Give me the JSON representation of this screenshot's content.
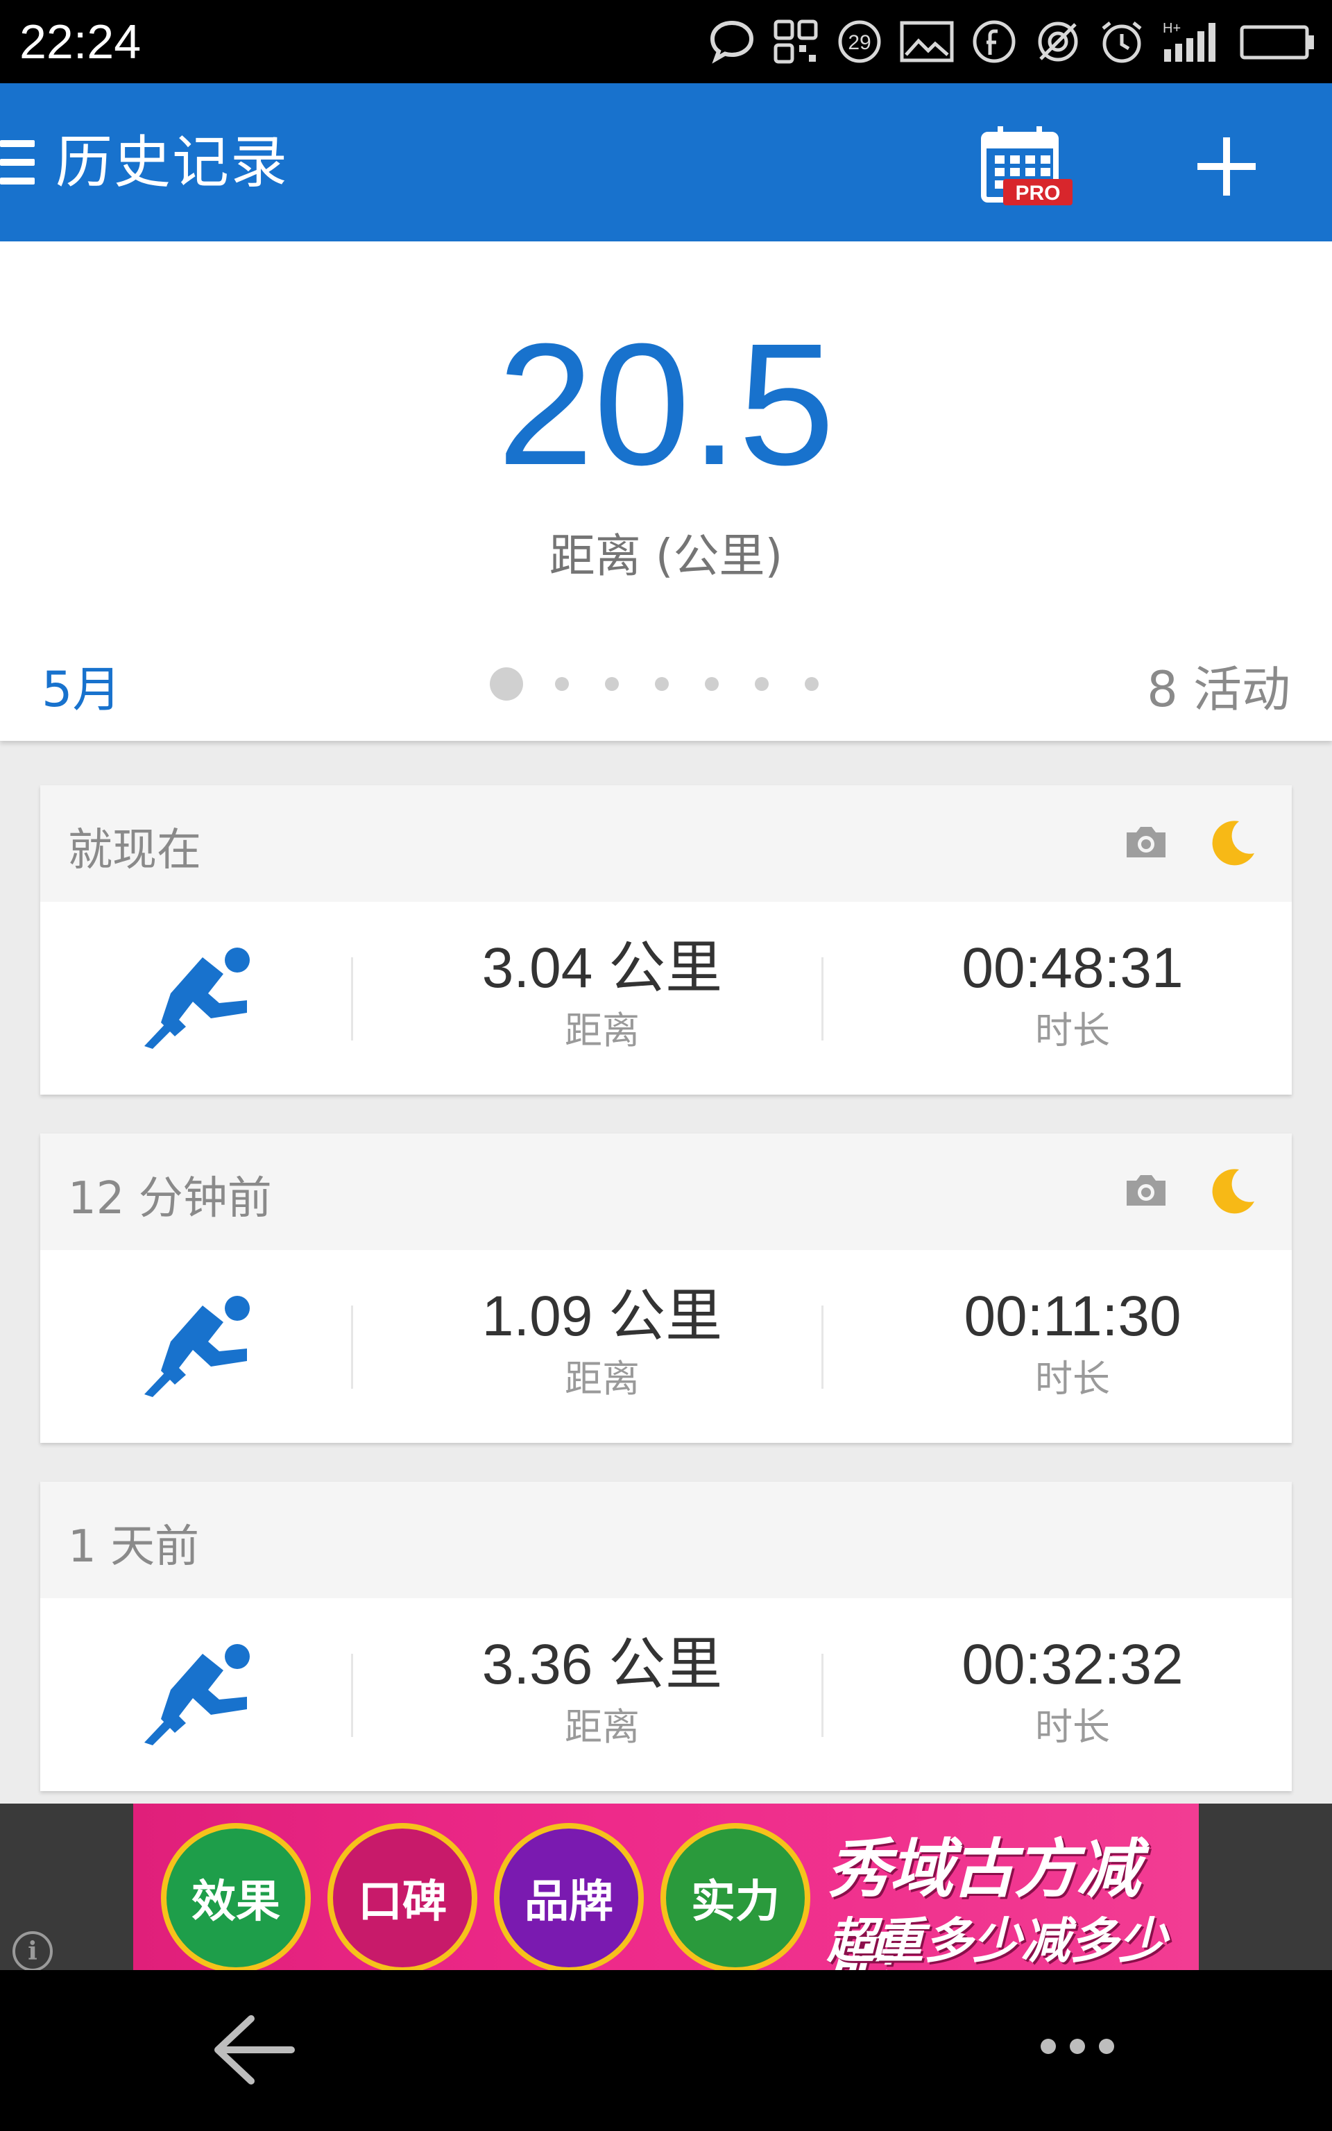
{
  "status_bar": {
    "time": "22:24",
    "calendar_day": "29",
    "icons": [
      "chat-icon",
      "qr-icon",
      "calendar-icon",
      "image-icon",
      "facebook-icon",
      "location-off-icon",
      "alarm-icon",
      "signal-icon",
      "battery-icon"
    ],
    "network": "H+"
  },
  "app_bar": {
    "title": "历史记录",
    "calendar_badge": "PRO",
    "color": "#1872cd"
  },
  "summary": {
    "value": "20.5",
    "unit_label": "距离 (公里)",
    "month": "5月",
    "activity_count": "8 活动",
    "page_dots": 7,
    "active_page": 0
  },
  "activities": [
    {
      "when": "就现在",
      "distance": "3.04 公里",
      "distance_label": "距离",
      "duration": "00:48:31",
      "duration_label": "时长",
      "has_photo": true,
      "night": true
    },
    {
      "when": "12 分钟前",
      "distance": "1.09 公里",
      "distance_label": "距离",
      "duration": "00:11:30",
      "duration_label": "时长",
      "has_photo": true,
      "night": true
    },
    {
      "when": "1 天前",
      "distance": "3.36 公里",
      "distance_label": "距离",
      "duration": "00:32:32",
      "duration_label": "时长",
      "has_photo": false,
      "night": false
    }
  ],
  "ad": {
    "badges": [
      "效果",
      "口碑",
      "品牌",
      "实力"
    ],
    "badge_colors": [
      "#1e9e4a",
      "#c81a6a",
      "#7a1ab0",
      "#2a9a3c"
    ],
    "headline": "秀域古方减肥",
    "sub": "超重多少减多少",
    "info_icon": "i"
  },
  "nav_bar": {
    "back_icon": "back-arrow-icon",
    "more_icon": "more-dots-icon"
  }
}
